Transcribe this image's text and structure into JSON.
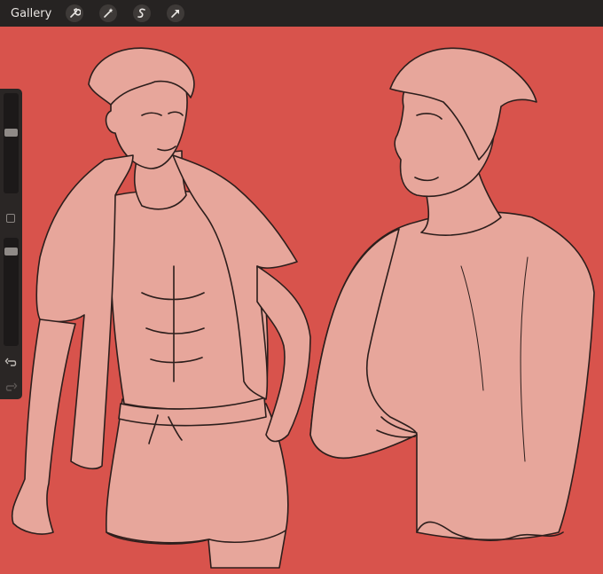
{
  "toolbar": {
    "gallery_label": "Gallery",
    "tools": [
      {
        "icon": "wrench-icon",
        "name": "actions"
      },
      {
        "icon": "magic-wand-icon",
        "name": "adjustments"
      },
      {
        "icon": "selection-s-icon",
        "name": "selection"
      },
      {
        "icon": "arrow-cursor-icon",
        "name": "transform"
      }
    ]
  },
  "sidebar": {
    "brush_size": 0.62,
    "opacity": 0.9,
    "undo_icon": "undo-arrow-icon",
    "redo_icon": "redo-arrow-icon"
  },
  "colors": {
    "toolbar_bg": "#262322",
    "canvas_bg": "#d8534c",
    "skin_fill": "#e7a69b",
    "line": "#2c1e1c"
  }
}
